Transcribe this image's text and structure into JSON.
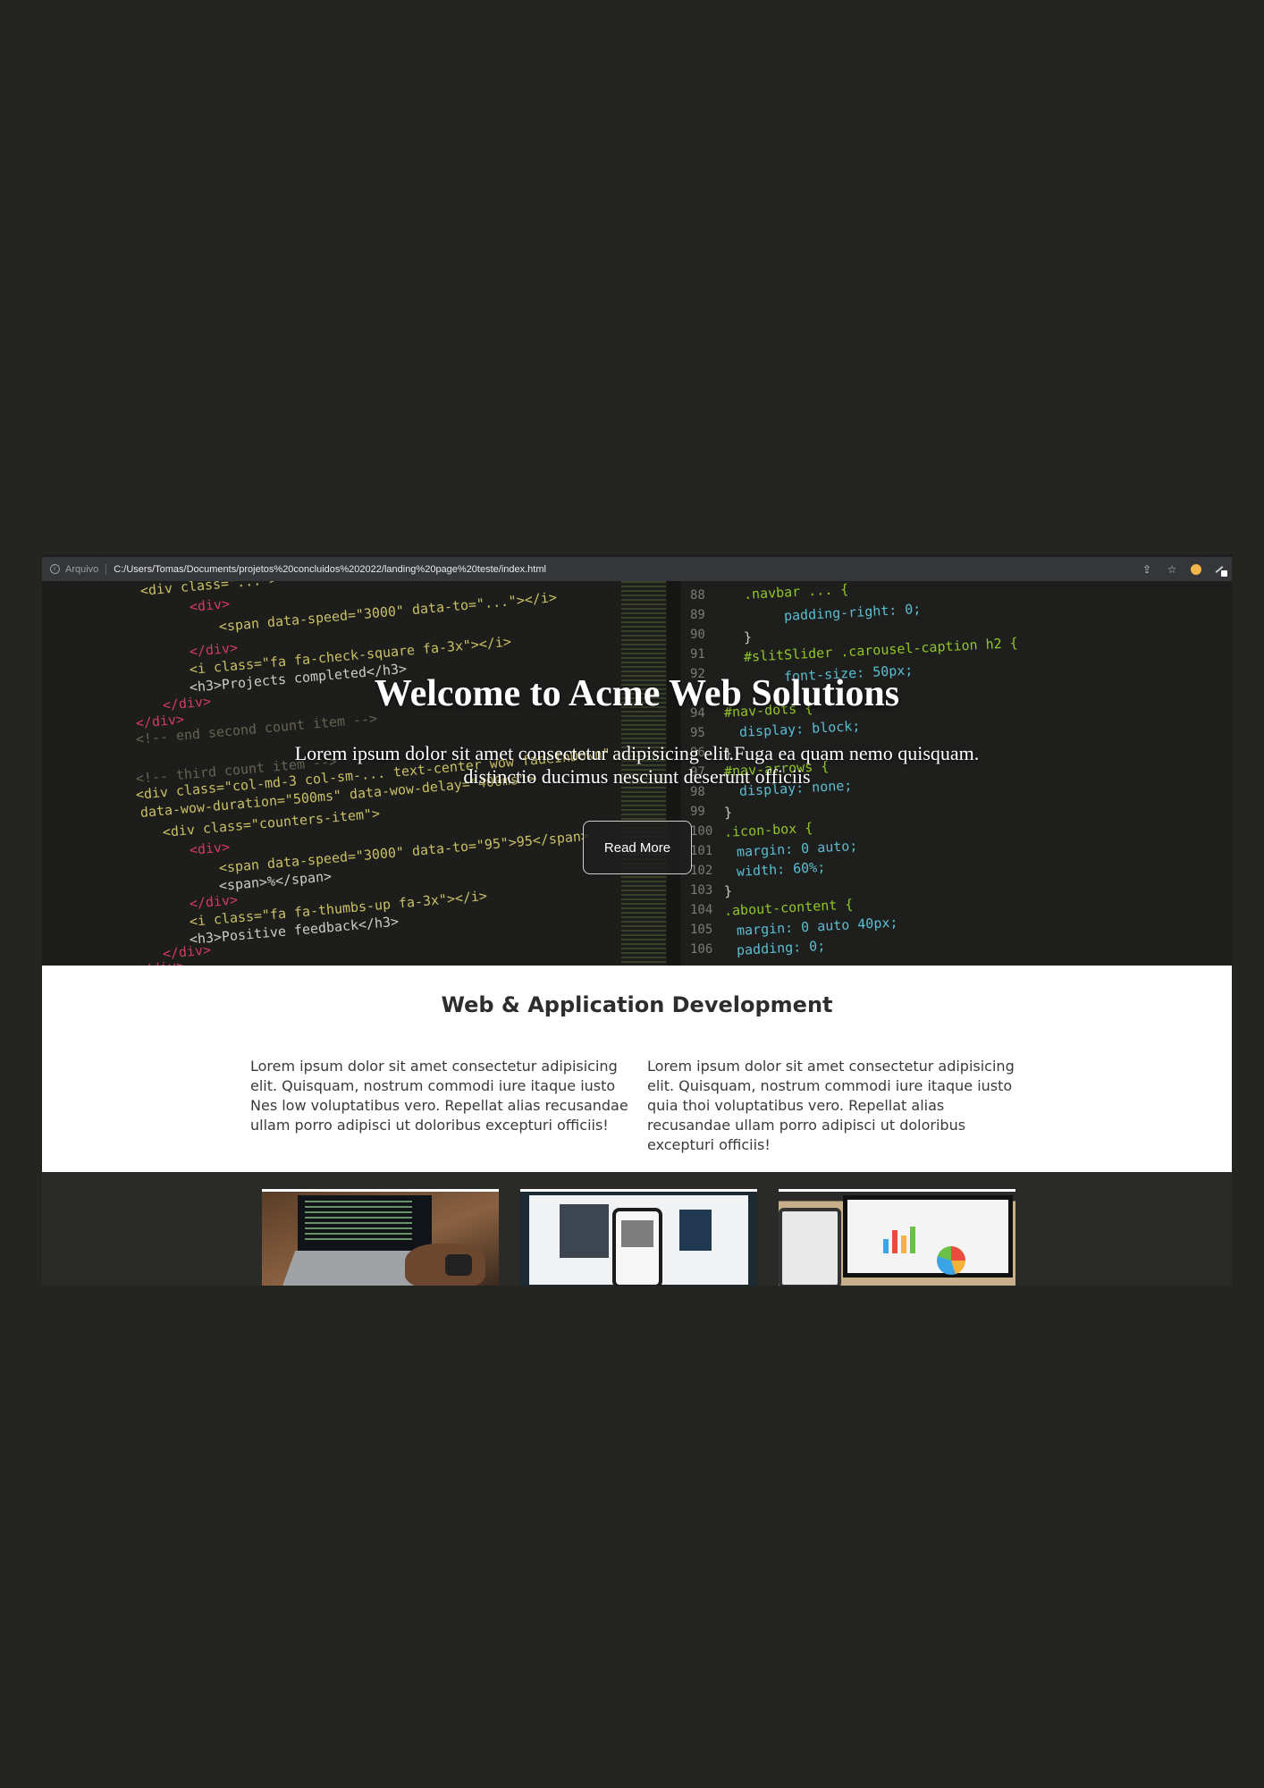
{
  "browser": {
    "origin_label": "Arquivo",
    "url": "C:/Users/Tomas/Documents/projetos%20concluidos%202022/landing%20page%20teste/index.html",
    "icons": [
      "info-icon",
      "share-icon",
      "star-icon",
      "profile-dot-icon",
      "extension-icon"
    ]
  },
  "hero": {
    "title": "Welcome to Acme Web Solutions",
    "subtitle_line1": "Lorem ipsum dolor sit amet consectetur adipisicing elit.Fuga ea quam nemo quisquam.",
    "subtitle_line2": "distinctio ducimus nesciunt deserunt officiis",
    "button_label": "Read More",
    "code_left": [
      {
        "text": "<div class=\"...\">"
      },
      {
        "text": "<div>"
      },
      {
        "text": "<span data-speed=\"3000\" data-to=\"...\"></i>"
      },
      {
        "text": "</div>"
      },
      {
        "text": "<i class=\"fa fa-check-square fa-3x\"></i>"
      },
      {
        "text": "<h3>Projects completed</h3>"
      },
      {
        "text": "</div>"
      },
      {
        "text": "</div>"
      },
      {
        "text": "<!-- end second count item -->"
      },
      {
        "text": "<!-- third count item -->"
      },
      {
        "text": "<div class=\"col-md-3 col-sm-... text-center wow fadeInDown\""
      },
      {
        "text": "data-wow-duration=\"500ms\" data-wow-delay=\"400ms\">"
      },
      {
        "text": "<div class=\"counters-item\">"
      },
      {
        "text": "<div>"
      },
      {
        "text": "<span data-speed=\"3000\" data-to=\"95\">95</span>"
      },
      {
        "text": "<span>%</span>"
      },
      {
        "text": "</div>"
      },
      {
        "text": "<i class=\"fa fa-thumbs-up fa-3x\"></i>"
      },
      {
        "text": "<h3>Positive feedback</h3>"
      },
      {
        "text": "</div>"
      },
      {
        "text": "</div>"
      }
    ],
    "code_right_lines": [
      "88",
      "89",
      "90",
      "91",
      "92",
      "94",
      "95",
      "96",
      "97",
      "98",
      "99",
      "100",
      "101",
      "102",
      "103",
      "104",
      "105",
      "106"
    ],
    "code_right": [
      {
        "text": ".navbar ... {"
      },
      {
        "text": "padding-right: 0;"
      },
      {
        "text": "}"
      },
      {
        "text": "#slitSlider .carousel-caption h2 {"
      },
      {
        "text": "font-size: 50px;"
      },
      {
        "text": "#nav-dots {"
      },
      {
        "text": "display: block;"
      },
      {
        "text": "}"
      },
      {
        "text": "#nav-arrows {"
      },
      {
        "text": "display: none;"
      },
      {
        "text": "}"
      },
      {
        "text": ".icon-box {"
      },
      {
        "text": "margin: 0 auto;"
      },
      {
        "text": "width: 60%;"
      },
      {
        "text": "}"
      },
      {
        "text": ".about-content {"
      },
      {
        "text": "margin: 0 auto 40px;"
      },
      {
        "text": "padding: 0;"
      }
    ]
  },
  "services": {
    "title": "Web & Application Development",
    "col1": "Lorem ipsum dolor sit amet consectetur adipisicing elit. Quisquam, nostrum commodi iure itaque iusto Nes low voluptatibus vero. Repellat alias recusandae ullam porro adipisci ut doloribus excepturi officiis!",
    "col2": "Lorem ipsum dolor sit amet consectetur adipisicing elit. Quisquam, nostrum commodi iure itaque iusto quia thoi voluptatibus vero. Repellat alias recusandae ullam porro adipisci ut doloribus excepturi officiis!"
  },
  "gallery": {
    "images": [
      "laptop-coding-photo",
      "phone-app-photo",
      "analytics-laptop-photo"
    ]
  },
  "colors": {
    "page_background": "#242420",
    "hero_text": "#ffffff",
    "section_background": "#ffffff",
    "heading_text": "#2d2d2d"
  }
}
